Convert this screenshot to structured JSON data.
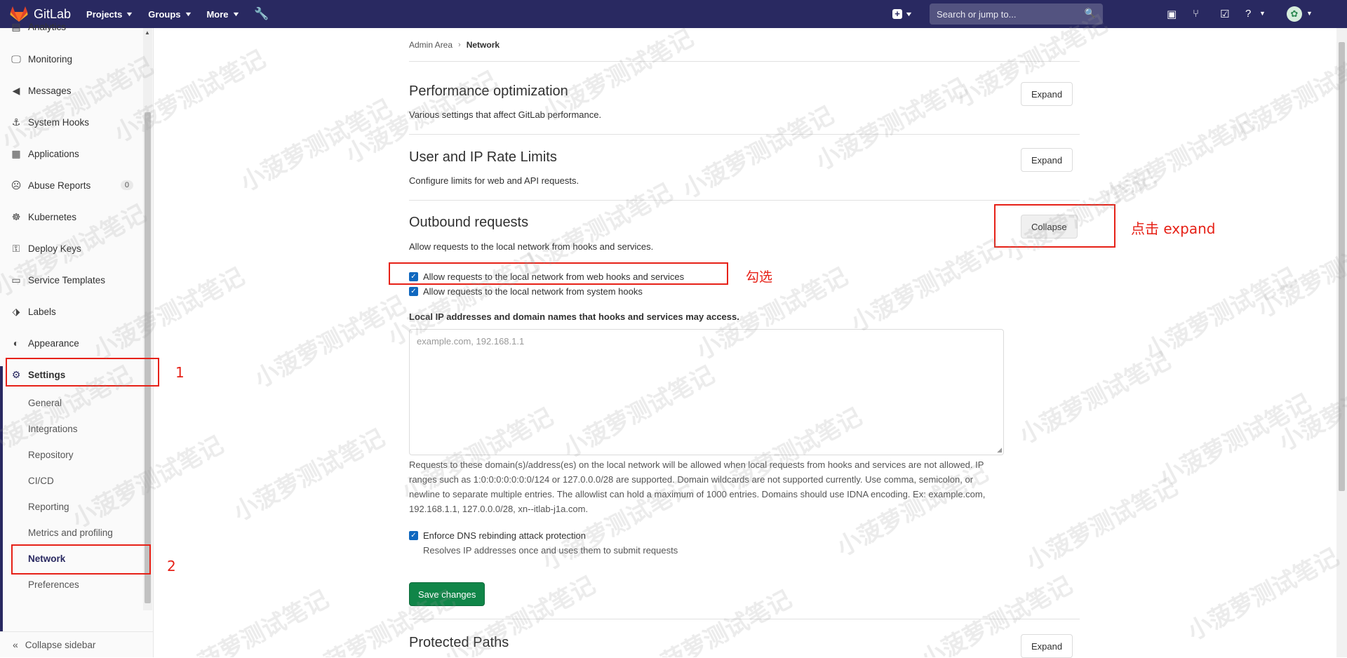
{
  "colors": {
    "navbar_bg": "#292961",
    "save_button": "#108548",
    "checkbox": "#1068bf",
    "annotation": "#e62117"
  },
  "navbar": {
    "brand": "GitLab",
    "items": [
      "Projects",
      "Groups",
      "More"
    ],
    "search_placeholder": "Search or jump to...",
    "icons": [
      "gitlab-logo-icon",
      "wrench-icon",
      "plus-square-icon",
      "search-icon",
      "todos-icon",
      "merge-request-icon",
      "issues-icon",
      "help-icon",
      "avatar-icon"
    ]
  },
  "sidebar": {
    "items": [
      {
        "label": "Analytics",
        "icon": "chart-icon"
      },
      {
        "label": "Monitoring",
        "icon": "monitor-icon"
      },
      {
        "label": "Messages",
        "icon": "messages-icon"
      },
      {
        "label": "System Hooks",
        "icon": "hook-icon"
      },
      {
        "label": "Applications",
        "icon": "applications-icon"
      },
      {
        "label": "Abuse Reports",
        "icon": "abuse-icon",
        "badge": "0"
      },
      {
        "label": "Kubernetes",
        "icon": "kubernetes-icon"
      },
      {
        "label": "Deploy Keys",
        "icon": "key-icon"
      },
      {
        "label": "Service Templates",
        "icon": "template-icon"
      },
      {
        "label": "Labels",
        "icon": "label-icon"
      },
      {
        "label": "Appearance",
        "icon": "appearance-icon"
      },
      {
        "label": "Settings",
        "icon": "gear-icon"
      }
    ],
    "settings_subitems": [
      "General",
      "Integrations",
      "Repository",
      "CI/CD",
      "Reporting",
      "Metrics and profiling",
      "Network",
      "Preferences"
    ],
    "active_subitem": "Network",
    "collapse_label": "Collapse sidebar"
  },
  "breadcrumb": {
    "parent": "Admin Area",
    "current": "Network"
  },
  "sections": {
    "performance": {
      "title": "Performance optimization",
      "description": "Various settings that affect GitLab performance.",
      "button": "Expand"
    },
    "rate_limits": {
      "title": "User and IP Rate Limits",
      "description": "Configure limits for web and API requests.",
      "button": "Expand"
    },
    "outbound": {
      "title": "Outbound requests",
      "description": "Allow requests to the local network from hooks and services.",
      "button": "Collapse",
      "checkbox_webhooks": {
        "label": "Allow requests to the local network from web hooks and services",
        "checked": true
      },
      "checkbox_systemhooks": {
        "label": "Allow requests to the local network from system hooks",
        "checked": true
      },
      "allowlist_label": "Local IP addresses and domain names that hooks and services may access.",
      "allowlist_placeholder": "example.com, 192.168.1.1",
      "allowlist_value": "",
      "help_text": "Requests to these domain(s)/address(es) on the local network will be allowed when local requests from hooks and services are not allowed. IP ranges such as 1:0:0:0:0:0:0:0/124 or 127.0.0.0/28 are supported. Domain wildcards are not supported currently. Use comma, semicolon, or newline to separate multiple entries. The allowlist can hold a maximum of 1000 entries. Domains should use IDNA encoding. Ex: example.com, 192.168.1.1, 127.0.0.0/28, xn--itlab-j1a.com.",
      "checkbox_dns": {
        "label": "Enforce DNS rebinding attack protection",
        "checked": true
      },
      "dns_help": "Resolves IP addresses once and uses them to submit requests",
      "save_button": "Save changes"
    },
    "protected_paths": {
      "title": "Protected Paths",
      "button": "Expand"
    }
  },
  "annotations": {
    "step1": "1",
    "step2": "2",
    "check_note": "勾选",
    "expand_note": "点击 expand"
  },
  "watermark": "小菠萝测试笔记"
}
